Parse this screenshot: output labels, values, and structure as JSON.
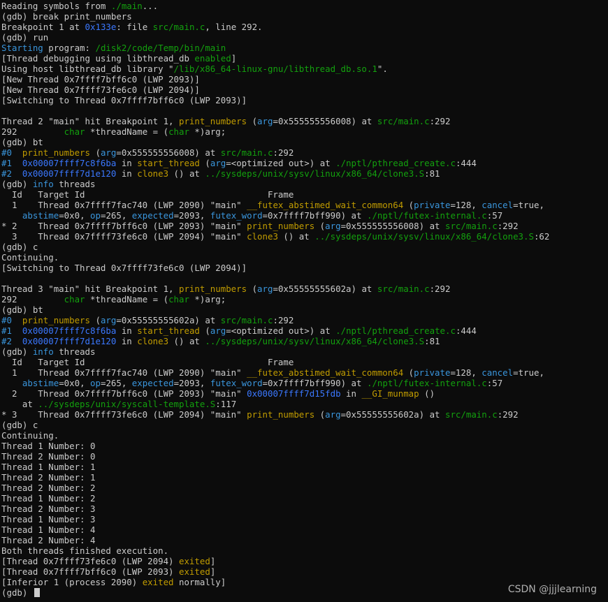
{
  "colors": {
    "default": "#cccccc",
    "cyan": "#3a96dd",
    "yellow": "#c19c00",
    "green": "#13a10e",
    "blue": "#3b78ff",
    "teal": "#3a96dd",
    "background": "#0c0c0c"
  },
  "lines": [
    [
      {
        "t": "Reading symbols from "
      },
      {
        "t": "./main",
        "c": "green"
      },
      {
        "t": "..."
      }
    ],
    [
      {
        "t": "(gdb) break print_numbers"
      }
    ],
    [
      {
        "t": "Breakpoint 1 at "
      },
      {
        "t": "0x133e",
        "c": "blue"
      },
      {
        "t": ": file "
      },
      {
        "t": "src/main.c",
        "c": "green"
      },
      {
        "t": ", line 292."
      }
    ],
    [
      {
        "t": "(gdb) run"
      }
    ],
    [
      {
        "t": "Starting",
        "c": "cyan"
      },
      {
        "t": " program: "
      },
      {
        "t": "/disk2/code/Temp/bin/main",
        "c": "green"
      }
    ],
    [
      {
        "t": "[Thread debugging using libthread_db "
      },
      {
        "t": "enabled",
        "c": "green"
      },
      {
        "t": "]"
      }
    ],
    [
      {
        "t": "Using host libthread_db library \""
      },
      {
        "t": "/lib/x86_64-linux-gnu/libthread_db.so.1",
        "c": "green"
      },
      {
        "t": "\"."
      }
    ],
    [
      {
        "t": "[New Thread 0x7ffff7bff6c0 (LWP 2093)]"
      }
    ],
    [
      {
        "t": "[New Thread 0x7ffff73fe6c0 (LWP 2094)]"
      }
    ],
    [
      {
        "t": "[Switching to Thread 0x7ffff7bff6c0 (LWP 2093)]"
      }
    ],
    [
      {
        "t": ""
      }
    ],
    [
      {
        "t": "Thread 2 \"main\" hit Breakpoint 1, "
      },
      {
        "t": "print_numbers",
        "c": "yellow"
      },
      {
        "t": " ("
      },
      {
        "t": "arg",
        "c": "cyan"
      },
      {
        "t": "=0x555555556008) at "
      },
      {
        "t": "src/main.c",
        "c": "green"
      },
      {
        "t": ":292"
      }
    ],
    [
      {
        "t": "292         "
      },
      {
        "t": "char",
        "c": "green"
      },
      {
        "t": " *threadName = ("
      },
      {
        "t": "char",
        "c": "green"
      },
      {
        "t": " *)arg;"
      }
    ],
    [
      {
        "t": "(gdb) bt"
      }
    ],
    [
      {
        "t": "#0  ",
        "c": "cyan"
      },
      {
        "t": "print_numbers",
        "c": "yellow"
      },
      {
        "t": " ("
      },
      {
        "t": "arg",
        "c": "cyan"
      },
      {
        "t": "=0x555555556008) at "
      },
      {
        "t": "src/main.c",
        "c": "green"
      },
      {
        "t": ":292"
      }
    ],
    [
      {
        "t": "#1  ",
        "c": "cyan"
      },
      {
        "t": "0x00007ffff7c8f6ba",
        "c": "blue"
      },
      {
        "t": " in "
      },
      {
        "t": "start_thread",
        "c": "yellow"
      },
      {
        "t": " ("
      },
      {
        "t": "arg",
        "c": "cyan"
      },
      {
        "t": "=<optimized out>) at "
      },
      {
        "t": "./nptl/pthread_create.c",
        "c": "green"
      },
      {
        "t": ":444"
      }
    ],
    [
      {
        "t": "#2  ",
        "c": "cyan"
      },
      {
        "t": "0x00007ffff7d1e120",
        "c": "blue"
      },
      {
        "t": " in "
      },
      {
        "t": "clone3",
        "c": "yellow"
      },
      {
        "t": " () at "
      },
      {
        "t": "../sysdeps/unix/sysv/linux/x86_64/clone3.S",
        "c": "green"
      },
      {
        "t": ":81"
      }
    ],
    [
      {
        "t": "(gdb) "
      },
      {
        "t": "info",
        "c": "cyan"
      },
      {
        "t": " threads"
      }
    ],
    [
      {
        "t": "  Id   Target Id                                   Frame"
      }
    ],
    [
      {
        "t": "  1    Thread 0x7ffff7fac740 (LWP 2090) \"main\" "
      },
      {
        "t": "__futex_abstimed_wait_common64",
        "c": "yellow"
      },
      {
        "t": " ("
      },
      {
        "t": "private",
        "c": "cyan"
      },
      {
        "t": "=128, "
      },
      {
        "t": "cancel",
        "c": "cyan"
      },
      {
        "t": "=true,"
      }
    ],
    [
      {
        "t": "    "
      },
      {
        "t": "abstime",
        "c": "cyan"
      },
      {
        "t": "=0x0, "
      },
      {
        "t": "op",
        "c": "cyan"
      },
      {
        "t": "=265, "
      },
      {
        "t": "expected",
        "c": "cyan"
      },
      {
        "t": "=2093, "
      },
      {
        "t": "futex_word",
        "c": "cyan"
      },
      {
        "t": "=0x7ffff7bff990) at "
      },
      {
        "t": "./nptl/futex-internal.c",
        "c": "green"
      },
      {
        "t": ":57"
      }
    ],
    [
      {
        "t": "* 2    Thread 0x7ffff7bff6c0 (LWP 2093) \"main\" "
      },
      {
        "t": "print_numbers",
        "c": "yellow"
      },
      {
        "t": " ("
      },
      {
        "t": "arg",
        "c": "cyan"
      },
      {
        "t": "=0x555555556008) at "
      },
      {
        "t": "src/main.c",
        "c": "green"
      },
      {
        "t": ":292"
      }
    ],
    [
      {
        "t": "  3    Thread 0x7ffff73fe6c0 (LWP 2094) \"main\" "
      },
      {
        "t": "clone3",
        "c": "yellow"
      },
      {
        "t": " () at "
      },
      {
        "t": "../sysdeps/unix/sysv/linux/x86_64/clone3.S",
        "c": "green"
      },
      {
        "t": ":62"
      }
    ],
    [
      {
        "t": "(gdb) c"
      }
    ],
    [
      {
        "t": "Continuing."
      }
    ],
    [
      {
        "t": "[Switching to Thread 0x7ffff73fe6c0 (LWP 2094)]"
      }
    ],
    [
      {
        "t": ""
      }
    ],
    [
      {
        "t": "Thread 3 \"main\" hit Breakpoint 1, "
      },
      {
        "t": "print_numbers",
        "c": "yellow"
      },
      {
        "t": " ("
      },
      {
        "t": "arg",
        "c": "cyan"
      },
      {
        "t": "=0x55555555602a) at "
      },
      {
        "t": "src/main.c",
        "c": "green"
      },
      {
        "t": ":292"
      }
    ],
    [
      {
        "t": "292         "
      },
      {
        "t": "char",
        "c": "green"
      },
      {
        "t": " *threadName = ("
      },
      {
        "t": "char",
        "c": "green"
      },
      {
        "t": " *)arg;"
      }
    ],
    [
      {
        "t": "(gdb) bt"
      }
    ],
    [
      {
        "t": "#0  ",
        "c": "cyan"
      },
      {
        "t": "print_numbers",
        "c": "yellow"
      },
      {
        "t": " ("
      },
      {
        "t": "arg",
        "c": "cyan"
      },
      {
        "t": "=0x55555555602a) at "
      },
      {
        "t": "src/main.c",
        "c": "green"
      },
      {
        "t": ":292"
      }
    ],
    [
      {
        "t": "#1  ",
        "c": "cyan"
      },
      {
        "t": "0x00007ffff7c8f6ba",
        "c": "blue"
      },
      {
        "t": " in "
      },
      {
        "t": "start_thread",
        "c": "yellow"
      },
      {
        "t": " ("
      },
      {
        "t": "arg",
        "c": "cyan"
      },
      {
        "t": "=<optimized out>) at "
      },
      {
        "t": "./nptl/pthread_create.c",
        "c": "green"
      },
      {
        "t": ":444"
      }
    ],
    [
      {
        "t": "#2  ",
        "c": "cyan"
      },
      {
        "t": "0x00007ffff7d1e120",
        "c": "blue"
      },
      {
        "t": " in "
      },
      {
        "t": "clone3",
        "c": "yellow"
      },
      {
        "t": " () at "
      },
      {
        "t": "../sysdeps/unix/sysv/linux/x86_64/clone3.S",
        "c": "green"
      },
      {
        "t": ":81"
      }
    ],
    [
      {
        "t": "(gdb) "
      },
      {
        "t": "info",
        "c": "cyan"
      },
      {
        "t": " threads"
      }
    ],
    [
      {
        "t": "  Id   Target Id                                   Frame"
      }
    ],
    [
      {
        "t": "  1    Thread 0x7ffff7fac740 (LWP 2090) \"main\" "
      },
      {
        "t": "__futex_abstimed_wait_common64",
        "c": "yellow"
      },
      {
        "t": " ("
      },
      {
        "t": "private",
        "c": "cyan"
      },
      {
        "t": "=128, "
      },
      {
        "t": "cancel",
        "c": "cyan"
      },
      {
        "t": "=true,"
      }
    ],
    [
      {
        "t": "    "
      },
      {
        "t": "abstime",
        "c": "cyan"
      },
      {
        "t": "=0x0, "
      },
      {
        "t": "op",
        "c": "cyan"
      },
      {
        "t": "=265, "
      },
      {
        "t": "expected",
        "c": "cyan"
      },
      {
        "t": "=2093, "
      },
      {
        "t": "futex_word",
        "c": "cyan"
      },
      {
        "t": "=0x7ffff7bff990) at "
      },
      {
        "t": "./nptl/futex-internal.c",
        "c": "green"
      },
      {
        "t": ":57"
      }
    ],
    [
      {
        "t": "  2    Thread 0x7ffff7bff6c0 (LWP 2093) \"main\" "
      },
      {
        "t": "0x00007ffff7d15fdb",
        "c": "blue"
      },
      {
        "t": " in "
      },
      {
        "t": "__GI_munmap",
        "c": "yellow"
      },
      {
        "t": " ()"
      }
    ],
    [
      {
        "t": "    at "
      },
      {
        "t": "../sysdeps/unix/syscall-template.S",
        "c": "green"
      },
      {
        "t": ":117"
      }
    ],
    [
      {
        "t": "* 3    Thread 0x7ffff73fe6c0 (LWP 2094) \"main\" "
      },
      {
        "t": "print_numbers",
        "c": "yellow"
      },
      {
        "t": " ("
      },
      {
        "t": "arg",
        "c": "cyan"
      },
      {
        "t": "=0x55555555602a) at "
      },
      {
        "t": "src/main.c",
        "c": "green"
      },
      {
        "t": ":292"
      }
    ],
    [
      {
        "t": "(gdb) c"
      }
    ],
    [
      {
        "t": "Continuing."
      }
    ],
    [
      {
        "t": "Thread 1 Number: 0"
      }
    ],
    [
      {
        "t": "Thread 2 Number: 0"
      }
    ],
    [
      {
        "t": "Thread 1 Number: 1"
      }
    ],
    [
      {
        "t": "Thread 2 Number: 1"
      }
    ],
    [
      {
        "t": "Thread 2 Number: 2"
      }
    ],
    [
      {
        "t": "Thread 1 Number: 2"
      }
    ],
    [
      {
        "t": "Thread 2 Number: 3"
      }
    ],
    [
      {
        "t": "Thread 1 Number: 3"
      }
    ],
    [
      {
        "t": "Thread 1 Number: 4"
      }
    ],
    [
      {
        "t": "Thread 2 Number: 4"
      }
    ],
    [
      {
        "t": "Both threads finished execution."
      }
    ],
    [
      {
        "t": "[Thread 0x7ffff73fe6c0 (LWP 2094) "
      },
      {
        "t": "exited",
        "c": "yellow"
      },
      {
        "t": "]"
      }
    ],
    [
      {
        "t": "[Thread 0x7ffff7bff6c0 (LWP 2093) "
      },
      {
        "t": "exited",
        "c": "yellow"
      },
      {
        "t": "]"
      }
    ],
    [
      {
        "t": "[Inferior 1 (process 2090) "
      },
      {
        "t": "exited",
        "c": "yellow"
      },
      {
        "t": " normally]"
      }
    ]
  ],
  "prompt": "(gdb) ",
  "watermark": "CSDN @jjjlearning"
}
